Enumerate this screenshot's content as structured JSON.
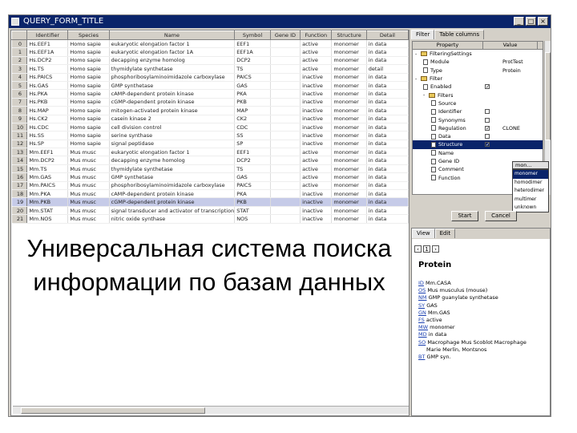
{
  "window": {
    "title": "QUERY_FORM_TITLE"
  },
  "table": {
    "columns": [
      "",
      "Identifier",
      "Species",
      "Name",
      "Symbol",
      "Gene ID",
      "Function",
      "Structure",
      "Detail"
    ],
    "rows": [
      [
        "0",
        "Hs.EEF1",
        "Homo sapie",
        "eukaryotic elongation factor 1",
        "EEF1",
        "",
        "active",
        "monomer",
        "in data"
      ],
      [
        "1",
        "Hs.EEF1A",
        "Homo sapie",
        "eukaryotic elongation factor 1A",
        "EEF1A",
        "",
        "active",
        "monomer",
        "in data"
      ],
      [
        "2",
        "Hs.DCP2",
        "Homo sapie",
        "decapping enzyme homolog",
        "DCP2",
        "",
        "active",
        "monomer",
        "in data"
      ],
      [
        "3",
        "Hs.TS",
        "Homo sapie",
        "thymidylate synthetase",
        "TS",
        "",
        "active",
        "monomer",
        "detail"
      ],
      [
        "4",
        "Hs.PAICS",
        "Homo sapie",
        "phosphoribosylaminoimidazole carboxylase",
        "PAICS",
        "",
        "inactive",
        "monomer",
        "in data"
      ],
      [
        "5",
        "Hs.GAS",
        "Homo sapie",
        "GMP synthetase",
        "GAS",
        "",
        "inactive",
        "monomer",
        "in data"
      ],
      [
        "6",
        "Hs.PKA",
        "Homo sapie",
        "cAMP-dependent protein kinase",
        "PKA",
        "",
        "inactive",
        "monomer",
        "in data"
      ],
      [
        "7",
        "Hs.PKB",
        "Homo sapie",
        "cGMP-dependent protein kinase",
        "PKB",
        "",
        "inactive",
        "monomer",
        "in data"
      ],
      [
        "8",
        "Hs.MAP",
        "Homo sapie",
        "mitogen-activated protein kinase",
        "MAP",
        "",
        "inactive",
        "monomer",
        "in data"
      ],
      [
        "9",
        "Hs.CK2",
        "Homo sapie",
        "casein kinase 2",
        "CK2",
        "",
        "inactive",
        "monomer",
        "in data"
      ],
      [
        "10",
        "Hs.CDC",
        "Homo sapie",
        "cell division control",
        "CDC",
        "",
        "inactive",
        "monomer",
        "in data"
      ],
      [
        "11",
        "Hs.SS",
        "Homo sapie",
        "serine synthase",
        "SS",
        "",
        "inactive",
        "monomer",
        "in data"
      ],
      [
        "12",
        "Hs.SP",
        "Homo sapie",
        "signal peptidase",
        "SP",
        "",
        "inactive",
        "monomer",
        "in data"
      ],
      [
        "13",
        "Mm.EEF1",
        "Mus musc",
        "eukaryotic elongation factor 1",
        "EEF1",
        "",
        "active",
        "monomer",
        "in data"
      ],
      [
        "14",
        "Mm.DCP2",
        "Mus musc",
        "decapping enzyme homolog",
        "DCP2",
        "",
        "active",
        "monomer",
        "in data"
      ],
      [
        "15",
        "Mm.TS",
        "Mus musc",
        "thymidylate synthetase",
        "TS",
        "",
        "active",
        "monomer",
        "in data"
      ],
      [
        "16",
        "Mm.GAS",
        "Mus musc",
        "GMP synthetase",
        "GAS",
        "",
        "active",
        "monomer",
        "in data"
      ],
      [
        "17",
        "Mm.PAICS",
        "Mus musc",
        "phosphoribosylaminoimidazole carboxylase",
        "PAICS",
        "",
        "active",
        "monomer",
        "in data"
      ],
      [
        "18",
        "Mm.PKA",
        "Mus musc",
        "cAMP-dependent protein kinase",
        "PKA",
        "",
        "inactive",
        "monomer",
        "in data"
      ],
      [
        "19",
        "Mm.PKB",
        "Mus musc",
        "cGMP-dependent protein kinase",
        "PKB",
        "",
        "inactive",
        "monomer",
        "in data"
      ],
      [
        "20",
        "Mm.STAT",
        "Mus musc",
        "signal transducer and activator of transcription",
        "STAT",
        "",
        "inactive",
        "monomer",
        "in data"
      ],
      [
        "21",
        "Mm.NOS",
        "Mus musc",
        "nitric oxide synthase",
        "NOS",
        "",
        "inactive",
        "monomer",
        "in data"
      ]
    ]
  },
  "slogan": "Универсальная система поиска информации по базам данных",
  "filter_panel": {
    "tabs": [
      "Filter",
      "Table columns"
    ],
    "headers": [
      "Property",
      "Value"
    ],
    "rows": [
      {
        "label": "FilteringSettings",
        "kind": "folder",
        "indent": 0,
        "toggle": "-"
      },
      {
        "label": "Module",
        "kind": "doc",
        "indent": 1,
        "value": "ProtTest"
      },
      {
        "label": "Type",
        "kind": "doc",
        "indent": 1,
        "value": "Protein"
      },
      {
        "label": "Filter",
        "kind": "folder",
        "indent": 0,
        "toggle": "-"
      },
      {
        "label": "Enabled",
        "kind": "doc",
        "indent": 1,
        "check": "✓"
      },
      {
        "label": "Filters",
        "kind": "folder",
        "indent": 1,
        "toggle": "-"
      },
      {
        "label": "Source",
        "kind": "doc",
        "indent": 2
      },
      {
        "label": "Identifier",
        "kind": "doc",
        "indent": 2,
        "check": " "
      },
      {
        "label": "Synonyms",
        "kind": "doc",
        "indent": 2,
        "check": " "
      },
      {
        "label": "Regulation",
        "kind": "doc",
        "indent": 2,
        "check": "✓",
        "value": "CLONE"
      },
      {
        "label": "Data",
        "kind": "doc",
        "indent": 2,
        "check": " "
      },
      {
        "label": "Structure",
        "kind": "doc",
        "indent": 2,
        "check": "✓",
        "selected": true
      },
      {
        "label": "Name",
        "kind": "doc",
        "indent": 2
      },
      {
        "label": "Gene ID",
        "kind": "doc",
        "indent": 2
      },
      {
        "label": "Comment",
        "kind": "doc",
        "indent": 2
      },
      {
        "label": "Function",
        "kind": "doc",
        "indent": 2
      }
    ],
    "combo_value": "mon...",
    "dropdown_options": [
      "monomer",
      "homodimer",
      "heterodimer",
      "multimer",
      "unknown"
    ],
    "start_label": "Start",
    "cancel_label": "Cancel"
  },
  "view_panel": {
    "tabs": [
      "View",
      "Edit"
    ],
    "page": "1",
    "title": "Protein",
    "lines": [
      {
        "key": "ID",
        "text": "Mm.CASA"
      },
      {
        "key": "OS",
        "text": "Mus musculus (mouse)"
      },
      {
        "key": "NM",
        "text": "GMP guanylate synthetase"
      },
      {
        "key": "SY",
        "text": "GAS"
      },
      {
        "key": "GN",
        "text": "Mm.GAS"
      },
      {
        "key": "FS",
        "text": "active"
      },
      {
        "key": "MW",
        "text": "monomer"
      },
      {
        "key": "MD",
        "text": "in data"
      },
      {
        "key": "SO",
        "text": "Macrophage Mus Scoblot Macrophage"
      },
      {
        "key": "",
        "text": "Marie Merlin, Montsnos"
      },
      {
        "key": "BT",
        "text": "GMP syn."
      }
    ]
  }
}
